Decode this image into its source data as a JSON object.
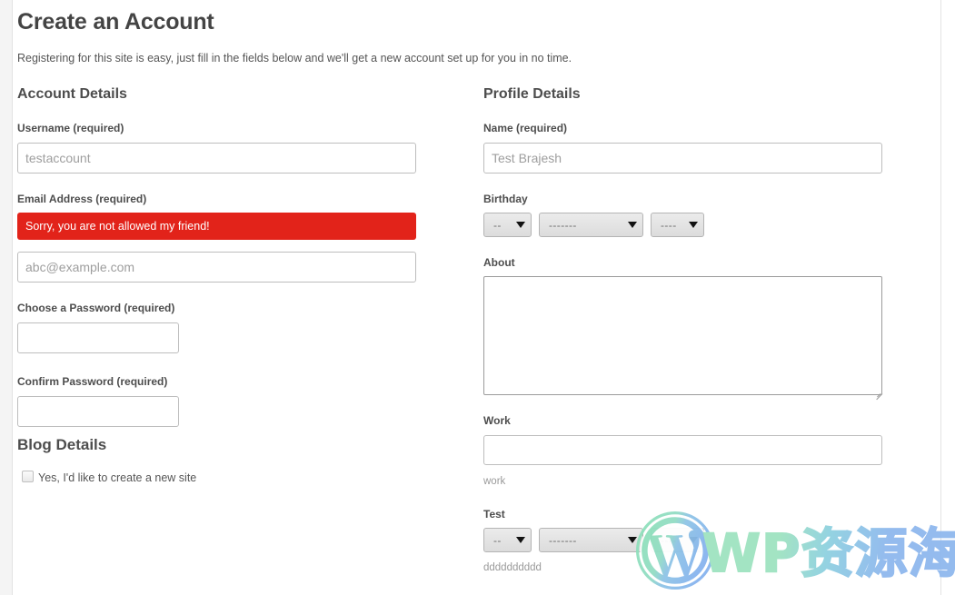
{
  "page": {
    "title": "Create an Account",
    "intro": "Registering for this site is easy, just fill in the fields below and we'll get a new account set up for you in no time."
  },
  "account_details": {
    "heading": "Account Details",
    "username": {
      "label": "Username (required)",
      "value": "",
      "placeholder": "testaccount"
    },
    "email": {
      "label": "Email Address (required)",
      "error": "Sorry, you are not allowed my friend!",
      "value": "",
      "placeholder": "abc@example.com"
    },
    "password": {
      "label": "Choose a Password (required)",
      "value": "",
      "placeholder": ""
    },
    "confirm_password": {
      "label": "Confirm Password (required)",
      "value": "",
      "placeholder": ""
    }
  },
  "blog_details": {
    "heading": "Blog Details",
    "create_site_checkbox": {
      "label": "Yes, I'd like to create a new site",
      "checked": false
    }
  },
  "profile_details": {
    "heading": "Profile Details",
    "name": {
      "label": "Name (required)",
      "value": "",
      "placeholder": "Test Brajesh"
    },
    "birthday": {
      "label": "Birthday",
      "day": "--",
      "month": "-------",
      "year": "----"
    },
    "about": {
      "label": "About",
      "value": "",
      "placeholder": ""
    },
    "work": {
      "label": "Work",
      "value": "",
      "placeholder": "",
      "help": "work"
    },
    "test": {
      "label": "Test",
      "day": "--",
      "month": "-------",
      "year": "----",
      "help": "dddddddddd"
    }
  },
  "watermark": {
    "text": "WP资源海",
    "logo": "wordpress-logo-icon"
  },
  "colors": {
    "error_red": "#e2231a",
    "text_dark": "#4d4d4d",
    "placeholder": "#9e9e9e",
    "border": "#bdbdbd",
    "page_bg": "#f4f4f4",
    "watermark_green": "#9fe3c0",
    "watermark_blue": "#8fb8ee"
  }
}
